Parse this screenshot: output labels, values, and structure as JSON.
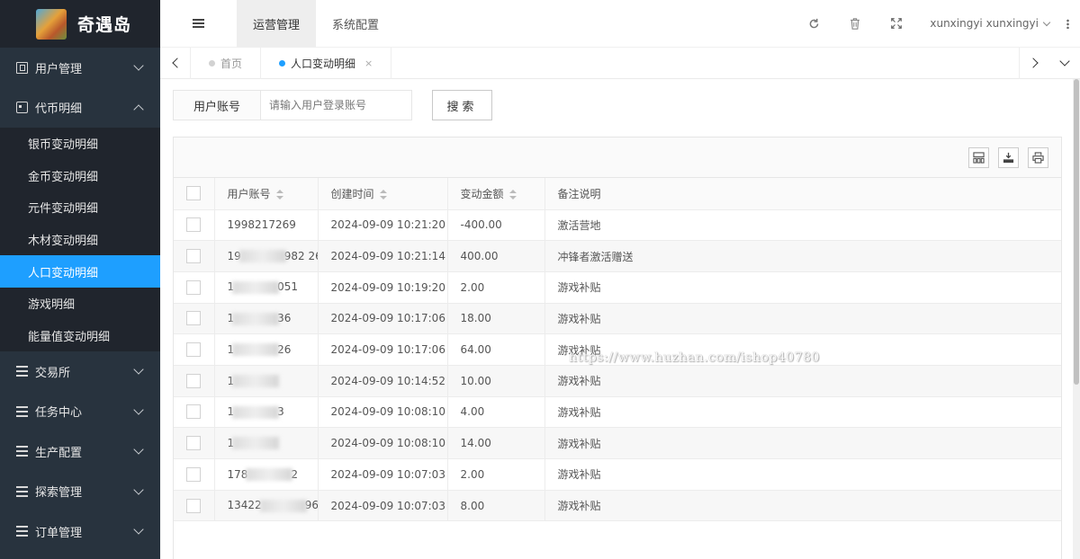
{
  "brand": {
    "name": "奇遇岛"
  },
  "sidebar": {
    "menus": [
      {
        "label": "用户管理",
        "icon": "user-box-icon",
        "expanded": false
      },
      {
        "label": "代币明细",
        "icon": "id-card-icon",
        "expanded": true,
        "children": [
          "银币变动明细",
          "金币变动明细",
          "元件变动明细",
          "木材变动明细",
          "人口变动明细",
          "游戏明细",
          "能量值变动明细"
        ],
        "active_child": "人口变动明细"
      },
      {
        "label": "交易所",
        "icon": "list-icon",
        "expanded": false
      },
      {
        "label": "任务中心",
        "icon": "list-icon",
        "expanded": false
      },
      {
        "label": "生产配置",
        "icon": "list-icon",
        "expanded": false
      },
      {
        "label": "探索管理",
        "icon": "list-icon",
        "expanded": false
      },
      {
        "label": "订单管理",
        "icon": "list-icon",
        "expanded": false
      }
    ]
  },
  "header": {
    "tabs": [
      "运营管理",
      "系统配置"
    ],
    "active_tab": "运营管理",
    "username": "xunxingyi xunxingyi"
  },
  "pagetabs": {
    "items": [
      {
        "label": "首页",
        "active": false
      },
      {
        "label": "人口变动明细",
        "active": true,
        "close": "×"
      }
    ]
  },
  "search": {
    "label": "用户账号",
    "placeholder": "请输入用户登录账号",
    "value": "",
    "button": "搜索"
  },
  "table": {
    "columns": [
      "用户账号",
      "创建时间",
      "变动金额",
      "备注说明"
    ],
    "rows": [
      {
        "account_pre": "19",
        "account_post": "98217269",
        "time": "2024-09-09 10:21:20",
        "amount": "-400.00",
        "note": "激活营地"
      },
      {
        "account_pre": "19",
        "account_post": "982 269",
        "time": "2024-09-09 10:21:14",
        "amount": "400.00",
        "note": "冲锋者激活赠送"
      },
      {
        "account_pre": "1",
        "account_post": "051",
        "time": "2024-09-09 10:19:20",
        "amount": "2.00",
        "note": "游戏补贴"
      },
      {
        "account_pre": "1",
        "account_post": "36",
        "time": "2024-09-09 10:17:06",
        "amount": "18.00",
        "note": "游戏补贴"
      },
      {
        "account_pre": "1",
        "account_post": "26",
        "time": "2024-09-09 10:17:06",
        "amount": "64.00",
        "note": "游戏补贴"
      },
      {
        "account_pre": "1",
        "account_post": "",
        "time": "2024-09-09 10:14:52",
        "amount": "10.00",
        "note": "游戏补贴"
      },
      {
        "account_pre": "1",
        "account_post": "3",
        "time": "2024-09-09 10:08:10",
        "amount": "4.00",
        "note": "游戏补贴"
      },
      {
        "account_pre": "1",
        "account_post": "",
        "time": "2024-09-09 10:08:10",
        "amount": "14.00",
        "note": "游戏补贴"
      },
      {
        "account_pre": "178",
        "account_post": "2",
        "time": "2024-09-09 10:07:03",
        "amount": "2.00",
        "note": "游戏补贴"
      },
      {
        "account_pre": "13422",
        "account_post": "96",
        "time": "2024-09-09 10:07:03",
        "amount": "8.00",
        "note": "游戏补贴"
      }
    ]
  },
  "watermark": "https://www.huzhan.com/ishop40780",
  "colors": {
    "sidebar_bg": "#28333e",
    "sidebar_dark": "#20252d",
    "accent": "#1e9fff"
  }
}
